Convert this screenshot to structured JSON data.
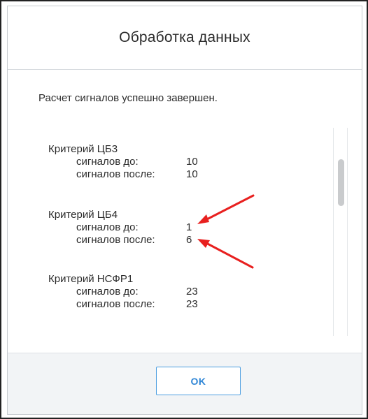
{
  "dialog": {
    "title": "Обработка данных",
    "status_message": "Расчет сигналов успешно завершен.",
    "ok_label": "OK"
  },
  "criteria": [
    {
      "title": "Критерий  ЦБ3",
      "before_label": "сигналов до:",
      "before_value": "10",
      "after_label": "сигналов после:",
      "after_value": "10"
    },
    {
      "title": "Критерий  ЦБ4",
      "before_label": "сигналов до:",
      "before_value": "1",
      "after_label": "сигналов после:",
      "after_value": "6"
    },
    {
      "title": "Критерий  НСФР1",
      "before_label": "сигналов до:",
      "before_value": "23",
      "after_label": "сигналов после:",
      "after_value": "23"
    }
  ],
  "annotation": {
    "arrow_color": "#e8201f"
  },
  "colors": {
    "accent": "#2f86d6",
    "footer_bg": "#f2f4f6",
    "scroll_thumb": "#c9cbcd"
  }
}
